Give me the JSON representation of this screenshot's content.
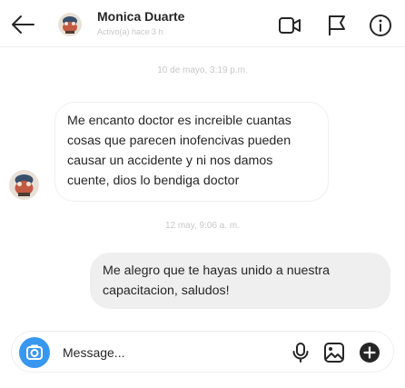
{
  "header": {
    "name": "Monica Duarte",
    "status": "Activo(a) hace 3 h"
  },
  "conversation": {
    "timestamp_1": "10 de mayo, 3:19 p.m.",
    "incoming_message": " Me encanto doctor es increible cuantas cosas que parecen inofencivas pueden causar un accidente y ni nos damos cuente, dios lo bendiga doctor",
    "timestamp_2": "12 may, 9:06 a. m.",
    "outgoing_message": "Me alegro que te hayas unido a nuestra capacitacion, saludos!"
  },
  "composer": {
    "placeholder": "Message..."
  },
  "icons": {
    "back": "arrow-left-icon",
    "video": "video-call-icon",
    "flag": "flag-icon",
    "info": "info-icon",
    "camera": "camera-icon",
    "mic": "microphone-icon",
    "gallery": "image-icon",
    "add": "add-circle-icon"
  },
  "colors": {
    "accent": "#3897f0",
    "outgoing_bubble": "#efefef",
    "muted_text": "#c7c7c7"
  }
}
